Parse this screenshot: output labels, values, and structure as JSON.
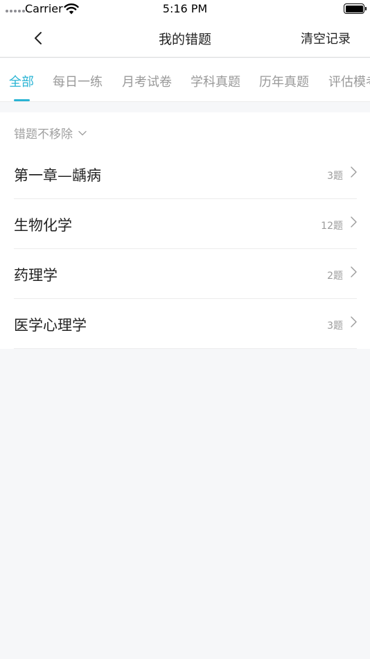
{
  "status_bar": {
    "carrier": "Carrier",
    "time": "5:16 PM"
  },
  "nav": {
    "title": "我的错题",
    "clear_label": "清空记录"
  },
  "tabs": [
    {
      "label": "全部",
      "active": true
    },
    {
      "label": "每日一练",
      "active": false
    },
    {
      "label": "月考试卷",
      "active": false
    },
    {
      "label": "学科真题",
      "active": false
    },
    {
      "label": "历年真题",
      "active": false
    },
    {
      "label": "评估模考",
      "active": false
    }
  ],
  "filter": {
    "label": "错题不移除"
  },
  "items": [
    {
      "title": "第一章—龋病",
      "count": "3题"
    },
    {
      "title": "生物化学",
      "count": "12题"
    },
    {
      "title": "药理学",
      "count": "2题"
    },
    {
      "title": "医学心理学",
      "count": "3题"
    }
  ],
  "colors": {
    "accent": "#2ab4d4",
    "background": "#f6f7f9"
  }
}
